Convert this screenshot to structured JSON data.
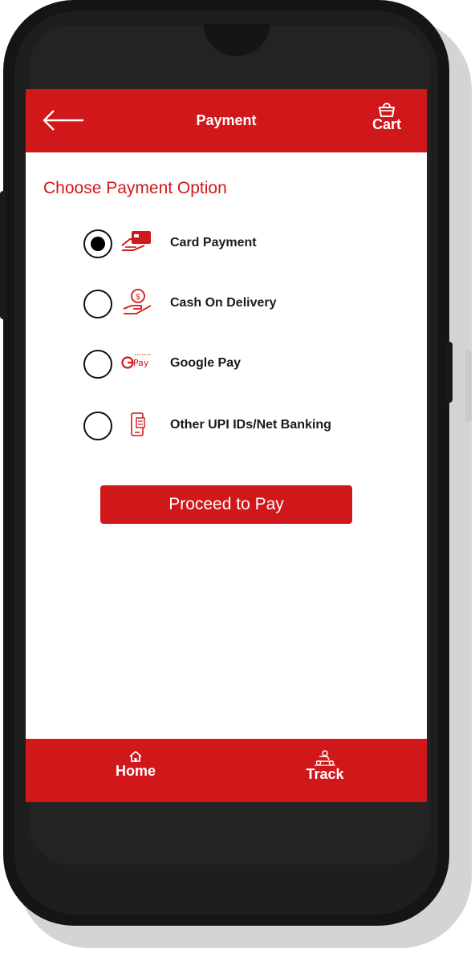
{
  "header": {
    "title": "Payment",
    "back_icon": "arrow-left-icon",
    "cart_label": "Cart",
    "cart_icon": "basket-icon"
  },
  "main": {
    "section_title": "Choose Payment Option",
    "options": [
      {
        "label": "Card Payment",
        "icon": "card-in-hand-icon",
        "selected": true
      },
      {
        "label": "Cash On Delivery",
        "icon": "cash-in-hand-icon",
        "selected": false
      },
      {
        "label": "Google Pay",
        "icon": "google-pay-icon",
        "icon_text": "Pay",
        "selected": false
      },
      {
        "label": "Other UPI IDs/Net Banking",
        "icon": "mobile-banking-icon",
        "selected": false
      }
    ],
    "proceed_label": "Proceed to Pay"
  },
  "bottom_nav": {
    "items": [
      {
        "label": "Home",
        "icon": "home-icon"
      },
      {
        "label": "Track",
        "icon": "delivery-scooter-icon"
      }
    ]
  },
  "colors": {
    "brand_red": "#d01719",
    "background": "#ffffff",
    "text": "#1a1a1a",
    "phone_frame": "#151515"
  }
}
